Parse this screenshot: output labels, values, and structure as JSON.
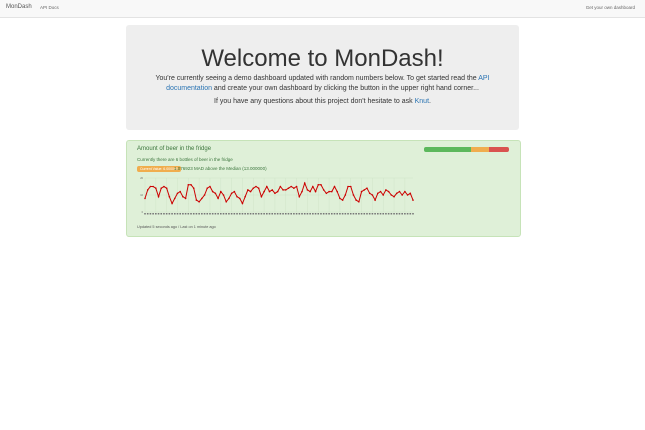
{
  "nav": {
    "brand": "MonDash",
    "api_docs": "API Docs",
    "get_dashboard": "Get your own dashboard"
  },
  "jumbotron": {
    "title": "Welcome to MonDash!",
    "intro_before_link": "You're currently seeing a demo dashboard updated with random numbers below. To get started read the ",
    "doc_link": "API documentation",
    "intro_after_link": " and create your own dashboard by clicking the button in the upper right hand corner...",
    "question_before_link": "If you have any questions about this project don't hesitate to ask ",
    "contact_link": "Knut",
    "question_after_link": "."
  },
  "widget": {
    "title": "Amount of beer in the fridge",
    "description": "Currently there are 6 bottles of beer in the fridge",
    "badge": "Current Value: 6.000000",
    "stat": "1.076923 MAD above the Median (13.000000)",
    "footer": "Updated 5 seconds ago / Last on 1 minute ago",
    "status_bar": {
      "green": 0.55,
      "orange": 0.22,
      "red": 0.23
    },
    "colors": {
      "line": "#cc0000",
      "grid": "#c8ddc0"
    }
  },
  "chart_data": {
    "type": "line",
    "ylim": [
      0,
      20
    ],
    "y_ticks": [
      0,
      10,
      20
    ],
    "values": [
      8,
      13,
      15,
      15,
      14,
      9,
      14,
      15,
      14,
      9,
      5,
      8,
      11,
      12,
      9,
      8,
      16,
      16,
      14,
      7,
      6,
      8,
      10,
      14,
      15,
      12,
      11,
      8,
      12,
      10,
      6,
      8,
      11,
      12,
      9,
      8,
      5,
      9,
      13,
      12,
      14,
      15,
      14,
      9,
      12,
      15,
      12,
      13,
      11,
      12,
      15,
      13,
      13,
      14,
      15,
      14,
      15,
      9,
      12,
      17,
      13,
      12,
      15,
      12,
      16,
      16,
      13,
      11,
      12,
      12,
      15,
      12,
      8,
      7,
      10,
      15,
      15,
      10,
      7,
      6,
      12,
      13,
      14,
      11,
      10,
      7,
      11,
      12,
      10,
      13,
      12,
      10,
      9,
      11,
      12,
      10,
      12,
      10,
      11,
      7
    ]
  }
}
